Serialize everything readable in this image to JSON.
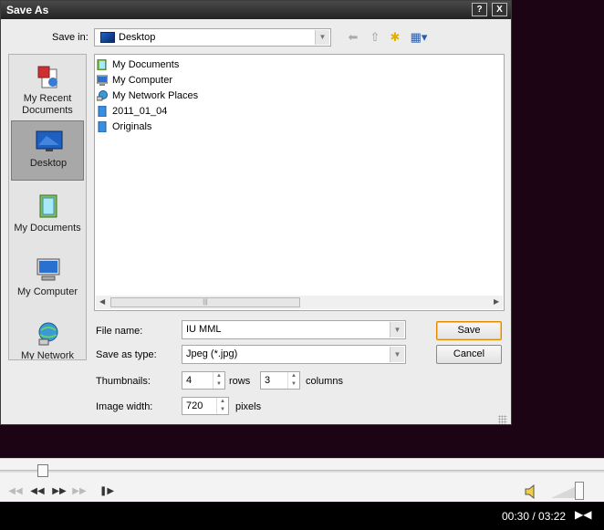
{
  "dialog": {
    "title": "Save As",
    "help_label": "?",
    "close_label": "X"
  },
  "save_in": {
    "label": "Save in:",
    "value": "Desktop"
  },
  "places": [
    {
      "label": "My Recent Documents",
      "icon": "recent-documents-icon",
      "active": false
    },
    {
      "label": "Desktop",
      "icon": "desktop-icon",
      "active": true
    },
    {
      "label": "My Documents",
      "icon": "my-documents-icon",
      "active": false
    },
    {
      "label": "My Computer",
      "icon": "my-computer-icon",
      "active": false
    },
    {
      "label": "My Network",
      "icon": "my-network-icon",
      "active": false
    }
  ],
  "files": [
    {
      "name": "My Documents",
      "icon": "my-documents-icon"
    },
    {
      "name": "My Computer",
      "icon": "my-computer-icon"
    },
    {
      "name": "My Network Places",
      "icon": "network-places-icon"
    },
    {
      "name": "2011_01_04",
      "icon": "folder-icon"
    },
    {
      "name": "Originals",
      "icon": "folder-icon"
    }
  ],
  "form": {
    "file_name_label": "File name:",
    "file_name_value": "IU MML",
    "save_type_label": "Save as type:",
    "save_type_value": "Jpeg (*.jpg)",
    "thumbnails_label": "Thumbnails:",
    "rows_value": "4",
    "rows_label": "rows",
    "columns_value": "3",
    "columns_label": "columns",
    "image_width_label": "Image width:",
    "image_width_value": "720",
    "pixels_label": "pixels"
  },
  "buttons": {
    "save": "Save",
    "cancel": "Cancel"
  },
  "player": {
    "time": "00:30 / 03:22"
  },
  "colors": {
    "default_button_border": "#e08a00",
    "player_background": "#1c0414"
  }
}
